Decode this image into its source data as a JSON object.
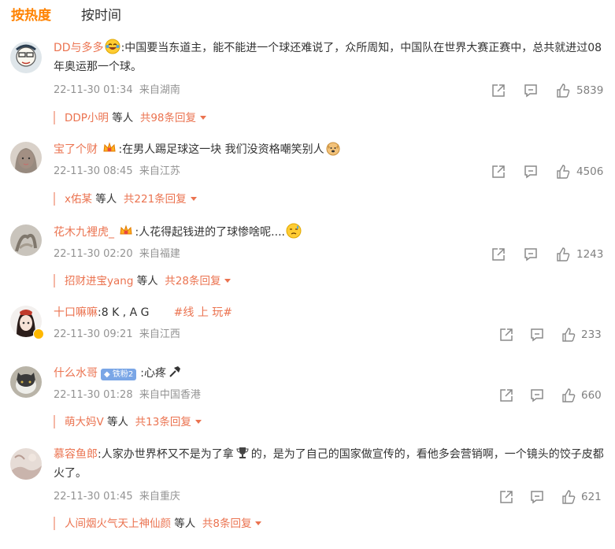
{
  "tabs": [
    {
      "label": "按热度",
      "active": true
    },
    {
      "label": "按时间",
      "active": false
    }
  ],
  "comments": [
    {
      "user": "DD与多多",
      "emoji_after_user": "laugh-cry-emoji",
      "text": ":中国要当东道主，能不能进一个球还难说了，众所周知，中国队在世界大赛正赛中，总共就进过08年奥运那一个球。",
      "time": "22-11-30 01:34",
      "location": "来自湖南",
      "likes": "5839",
      "reply": {
        "name": "DDP小明",
        "etc": "等人",
        "more": "共98条回复"
      }
    },
    {
      "user": "宝了个财",
      "badge_icon": "crown-emoji",
      "text": ":在男人踢足球这一块 我们没资格嘲笑别人",
      "emoji_after_text": "doge-emoji",
      "time": "22-11-30 08:45",
      "location": "来自江苏",
      "likes": "4506",
      "reply": {
        "name": "x佑某",
        "etc": "等人",
        "more": "共221条回复"
      }
    },
    {
      "user": "花木九裡虎_",
      "badge_icon": "crown-emoji",
      "text": ":人花得起钱进的了球惨啥呢....",
      "emoji_after_text": "sweat-emoji",
      "time": "22-11-30 02:20",
      "location": "来自福建",
      "likes": "1243",
      "reply": {
        "name": "招财进宝yang",
        "etc": "等人",
        "more": "共28条回复"
      }
    },
    {
      "user": "十口嘛嘛",
      "text": ":8 K , A G",
      "topic": "#线 上 玩#",
      "time": "22-11-30 09:21",
      "location": "来自江西",
      "likes": "233",
      "verified": true
    },
    {
      "user": "什么水哥",
      "fan_tag": "铁粉2",
      "text": ":心疼",
      "emoji_after_text": "hammer-icon",
      "time": "22-11-30 01:28",
      "location": "来自中国香港",
      "likes": "660",
      "reply": {
        "name": "萌大妈V",
        "etc": "等人",
        "more": "共13条回复"
      }
    },
    {
      "user": "慕容鱼郎",
      "text_a": ":人家办世界杯又不是为了拿",
      "emoji_mid": "trophy-emoji",
      "text_b": "的，是为了自己的国家做宣传的，看他多会营销啊，一个镜头的饺子皮都火了。",
      "time": "22-11-30 01:45",
      "location": "来自重庆",
      "likes": "621",
      "reply": {
        "name": "人间烟火气天上神仙颜",
        "etc": "等人",
        "more": "共8条回复"
      }
    }
  ],
  "colors": {
    "accent": "#ff8200",
    "username": "#eb7350",
    "meta": "#939393",
    "text": "#333333"
  }
}
